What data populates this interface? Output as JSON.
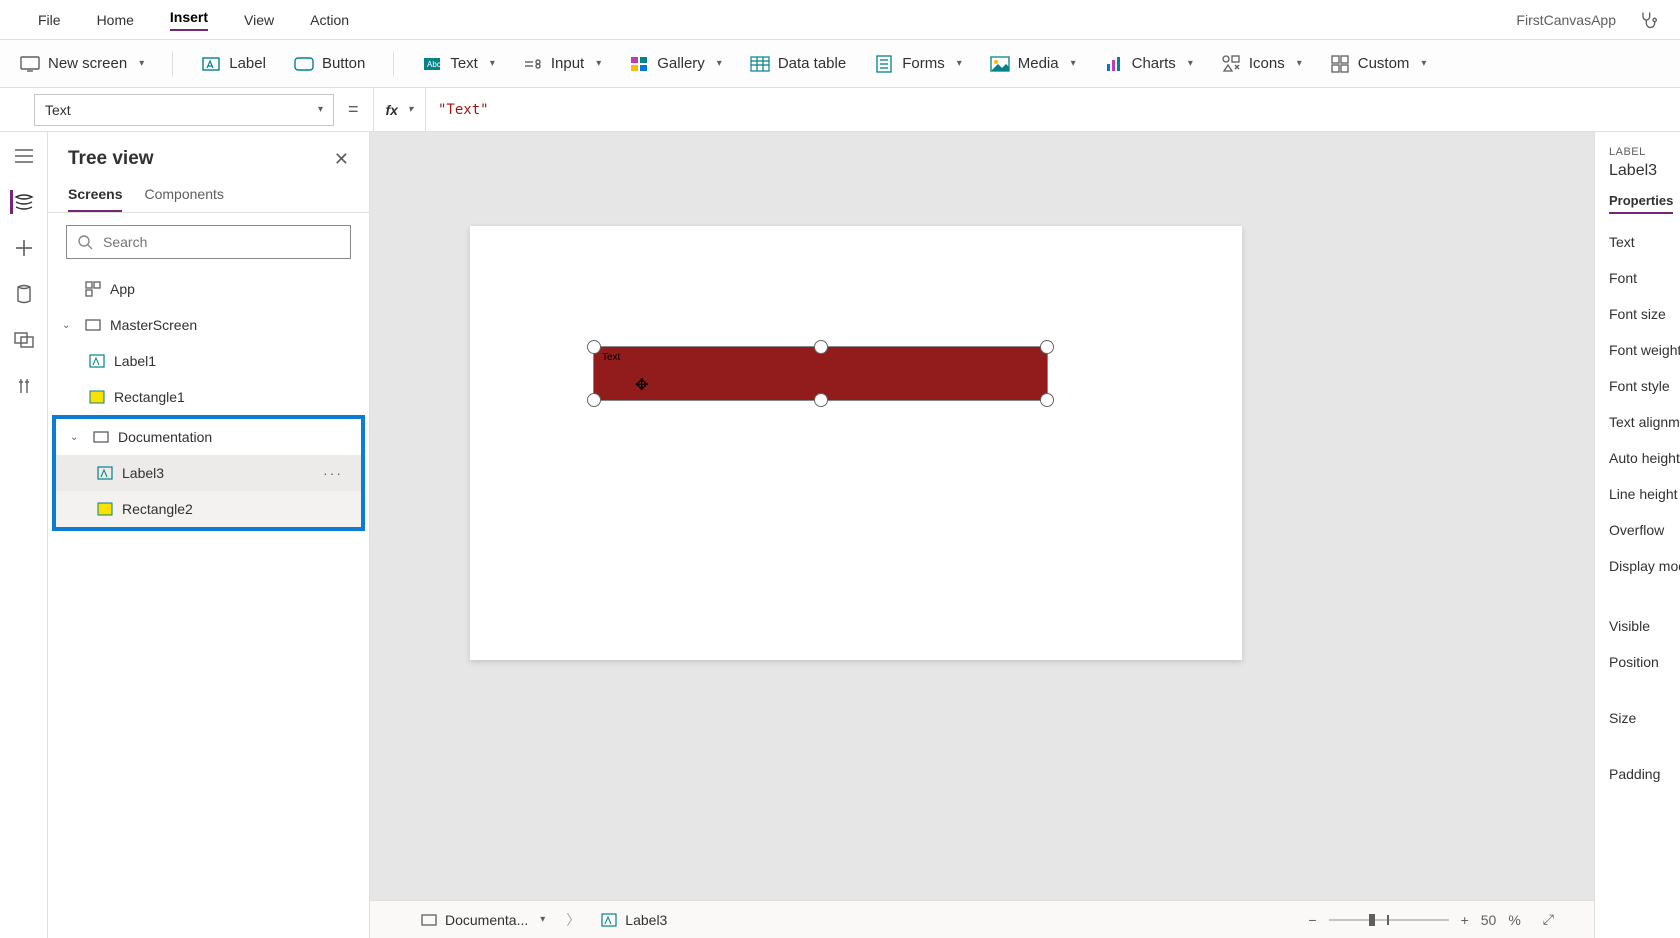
{
  "menu": {
    "items": [
      "File",
      "Home",
      "Insert",
      "View",
      "Action"
    ],
    "active": "Insert",
    "appname": "FirstCanvasApp"
  },
  "ribbon": {
    "newscreen": "New screen",
    "label": "Label",
    "button": "Button",
    "text": "Text",
    "input": "Input",
    "gallery": "Gallery",
    "datatable": "Data table",
    "forms": "Forms",
    "media": "Media",
    "charts": "Charts",
    "icons": "Icons",
    "custom": "Custom"
  },
  "formula": {
    "property": "Text",
    "value": "\"Text\""
  },
  "tree": {
    "title": "Tree view",
    "tabs": {
      "screens": "Screens",
      "components": "Components"
    },
    "search_placeholder": "Search",
    "app": "App",
    "master": "MasterScreen",
    "label1": "Label1",
    "rect1": "Rectangle1",
    "doc": "Documentation",
    "label3": "Label3",
    "rect2": "Rectangle2"
  },
  "canvas": {
    "selected_text": "Text"
  },
  "breadcrumb": {
    "screen": "Documenta...",
    "control": "Label3"
  },
  "zoom": {
    "value": "50",
    "unit": "%"
  },
  "props": {
    "kind": "LABEL",
    "name": "Label3",
    "tab": "Properties",
    "rows": [
      "Text",
      "Font",
      "Font size",
      "Font weight",
      "Font style",
      "Text alignme",
      "Auto height",
      "Line height",
      "Overflow",
      "Display mod",
      "Visible",
      "Position",
      "Size",
      "Padding"
    ]
  }
}
